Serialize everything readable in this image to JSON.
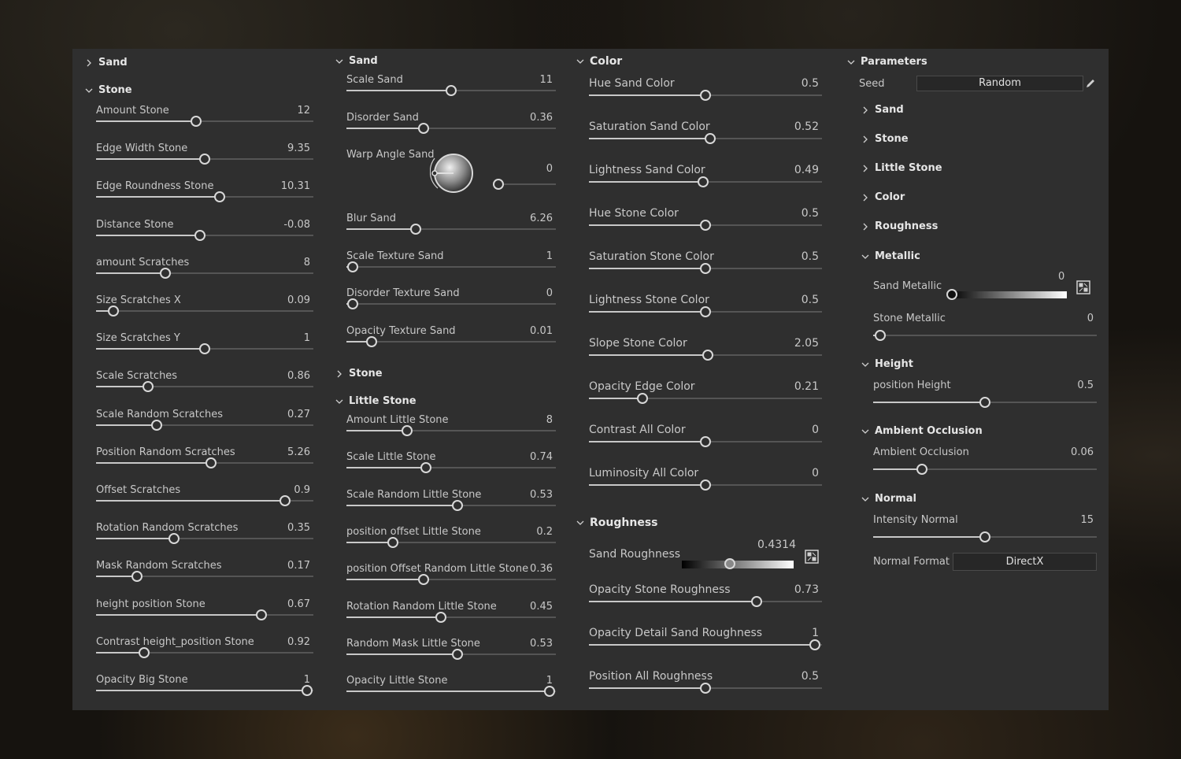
{
  "colors": {
    "panel": "#2f2f2f",
    "track": "#555555",
    "fill": "#c8c8c8",
    "text": "#c8c8c8",
    "header": "#e6e6e6"
  },
  "col1": {
    "sand_header": "Sand",
    "sand_state": "collapsed",
    "stone_header": "Stone",
    "stone_state": "expanded",
    "params": [
      {
        "label": "Amount Stone",
        "value": "12",
        "fraction": 0.46
      },
      {
        "label": "Edge Width Stone",
        "value": "9.35",
        "fraction": 0.5
      },
      {
        "label": "Edge Roundness Stone",
        "value": "10.31",
        "fraction": 0.57
      },
      {
        "label": "Distance Stone",
        "value": "-0.08",
        "fraction": 0.48
      },
      {
        "label": "amount Scratches",
        "value": "8",
        "fraction": 0.32
      },
      {
        "label": "Size Scratches X",
        "value": "0.09",
        "fraction": 0.08
      },
      {
        "label": "Size Scratches Y",
        "value": "1",
        "fraction": 0.5
      },
      {
        "label": "Scale Scratches",
        "value": "0.86",
        "fraction": 0.24
      },
      {
        "label": "Scale Random Scratches",
        "value": "0.27",
        "fraction": 0.28
      },
      {
        "label": "Position Random Scratches",
        "value": "5.26",
        "fraction": 0.53
      },
      {
        "label": "Offset Scratches",
        "value": "0.9",
        "fraction": 0.87
      },
      {
        "label": "Rotation Random Scratches",
        "value": "0.35",
        "fraction": 0.36
      },
      {
        "label": "Mask Random Scratches",
        "value": "0.17",
        "fraction": 0.19
      },
      {
        "label": "height position Stone",
        "value": "0.67",
        "fraction": 0.76
      },
      {
        "label": "Contrast height_position Stone",
        "value": "0.92",
        "fraction": 0.22
      },
      {
        "label": "Opacity Big Stone",
        "value": "1",
        "fraction": 0.97
      }
    ]
  },
  "col2": {
    "sand_header": "Sand",
    "sand_state": "expanded",
    "sand_params_a": [
      {
        "label": "Scale Sand",
        "value": "11",
        "fraction": 0.5
      },
      {
        "label": "Disorder Sand",
        "value": "0.36",
        "fraction": 0.37
      }
    ],
    "warp": {
      "label": "Warp Angle Sand",
      "value": "0",
      "fraction": 0.0
    },
    "sand_params_b": [
      {
        "label": "Blur Sand",
        "value": "6.26",
        "fraction": 0.33
      },
      {
        "label": "Scale Texture Sand",
        "value": "1",
        "fraction": 0.03
      },
      {
        "label": "Disorder Texture Sand",
        "value": "0",
        "fraction": 0.03
      },
      {
        "label": "Opacity Texture Sand",
        "value": "0.01",
        "fraction": 0.12
      }
    ],
    "stone_header": "Stone",
    "stone_state": "collapsed",
    "little_header": "Little Stone",
    "little_state": "expanded",
    "little_params": [
      {
        "label": "Amount Little Stone",
        "value": "8",
        "fraction": 0.29
      },
      {
        "label": "Scale Little Stone",
        "value": "0.74",
        "fraction": 0.38
      },
      {
        "label": "Scale Random Little Stone",
        "value": "0.53",
        "fraction": 0.53
      },
      {
        "label": "position offset Little Stone",
        "value": "0.2",
        "fraction": 0.22
      },
      {
        "label": "position Offset Random Little Stone",
        "value": "0.36",
        "fraction": 0.37
      },
      {
        "label": "Rotation Random Little Stone",
        "value": "0.45",
        "fraction": 0.45
      },
      {
        "label": "Random Mask Little Stone",
        "value": "0.53",
        "fraction": 0.53
      },
      {
        "label": "Opacity Little Stone",
        "value": "1",
        "fraction": 0.97
      }
    ]
  },
  "col3": {
    "color_header": "Color",
    "color_state": "expanded",
    "color_params": [
      {
        "label": "Hue Sand Color",
        "value": "0.5",
        "fraction": 0.5
      },
      {
        "label": "Saturation Sand Color",
        "value": "0.52",
        "fraction": 0.52
      },
      {
        "label": "Lightness Sand Color",
        "value": "0.49",
        "fraction": 0.49
      },
      {
        "label": "Hue Stone Color",
        "value": "0.5",
        "fraction": 0.5
      },
      {
        "label": "Saturation Stone Color",
        "value": "0.5",
        "fraction": 0.5
      },
      {
        "label": "Lightness Stone Color",
        "value": "0.5",
        "fraction": 0.5
      },
      {
        "label": "Slope Stone Color",
        "value": "2.05",
        "fraction": 0.51
      },
      {
        "label": "Opacity Edge Color",
        "value": "0.21",
        "fraction": 0.23
      },
      {
        "label": "Contrast All Color",
        "value": "0",
        "fraction": 0.5
      },
      {
        "label": "Luminosity All Color",
        "value": "0",
        "fraction": 0.5
      }
    ],
    "rough_header": "Roughness",
    "rough_state": "expanded",
    "sand_roughness": {
      "label": "Sand Roughness",
      "value": "0.4314",
      "fraction": 0.43
    },
    "rough_params": [
      {
        "label": "Opacity Stone Roughness",
        "value": "0.73",
        "fraction": 0.72
      },
      {
        "label": "Opacity Detail Sand Roughness",
        "value": "1",
        "fraction": 0.97
      },
      {
        "label": "Position All Roughness",
        "value": "0.5",
        "fraction": 0.5
      }
    ]
  },
  "col4": {
    "params_header": "Parameters",
    "params_state": "expanded",
    "seed_label": "Seed",
    "seed_value": "Random",
    "collapsed": [
      {
        "label": "Sand"
      },
      {
        "label": "Stone"
      },
      {
        "label": "Little Stone"
      },
      {
        "label": "Color"
      },
      {
        "label": "Roughness"
      }
    ],
    "metallic_header": "Metallic",
    "metallic_state": "expanded",
    "sand_metallic": {
      "label": "Sand Metallic",
      "value": "0",
      "fraction": 0.0
    },
    "stone_metallic": {
      "label": "Stone Metallic",
      "value": "0",
      "fraction": 0.03
    },
    "height_header": "Height",
    "height_state": "expanded",
    "position_height": {
      "label": "position Height",
      "value": "0.5",
      "fraction": 0.5
    },
    "ao_header": "Ambient Occlusion",
    "ao_state": "expanded",
    "ao_param": {
      "label": "Ambient Occlusion",
      "value": "0.06",
      "fraction": 0.22
    },
    "normal_header": "Normal",
    "normal_state": "expanded",
    "intensity_normal": {
      "label": "Intensity Normal",
      "value": "15",
      "fraction": 0.5
    },
    "normal_format_label": "Normal Format",
    "normal_format_value": "DirectX"
  }
}
